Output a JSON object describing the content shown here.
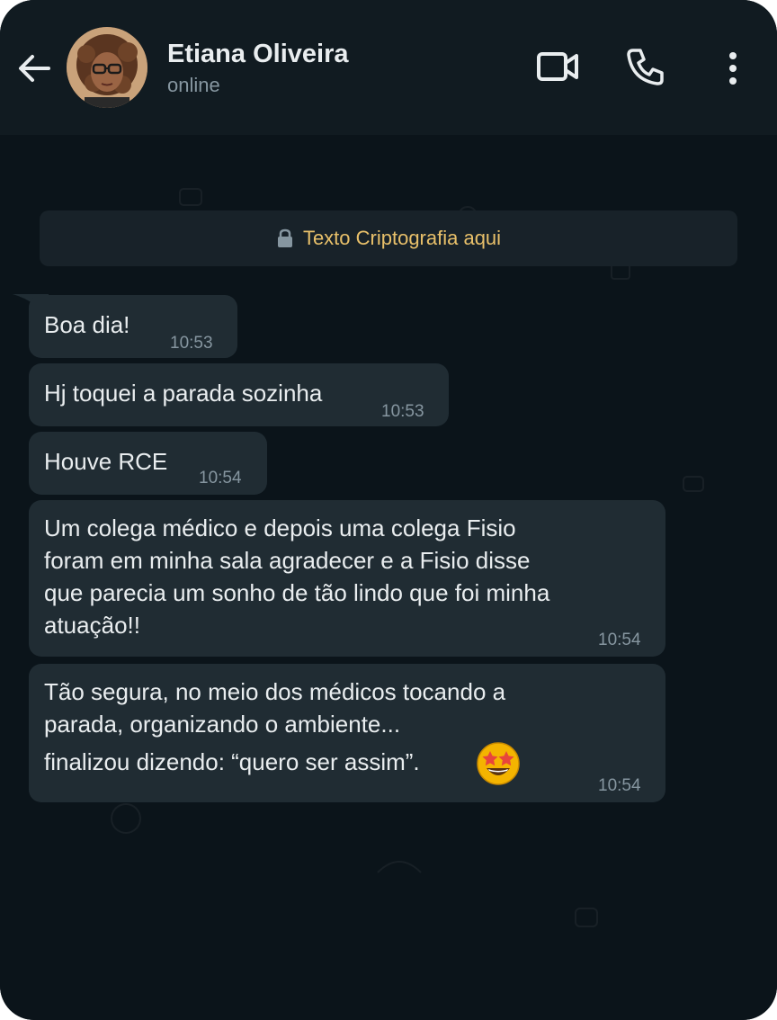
{
  "header": {
    "contact_name": "Etiana Oliveira",
    "status": "online"
  },
  "icons": [
    "back-arrow-icon",
    "video-call-icon",
    "phone-icon",
    "more-vertical-icon",
    "lock-icon",
    "star-struck-emoji"
  ],
  "colors": {
    "header_bg": "#111b21",
    "chat_bg": "#0b141a",
    "bubble_bg": "#202c33",
    "notice_text": "#e8c06a"
  },
  "system_notice": {
    "text": "Texto Criptografia aqui"
  },
  "messages": [
    {
      "lines": [
        "Boa dia!"
      ],
      "time": "10:53"
    },
    {
      "lines": [
        "Hj toquei a parada sozinha"
      ],
      "time": "10:53"
    },
    {
      "lines": [
        "Houve RCE"
      ],
      "time": "10:54"
    },
    {
      "lines": [
        "Um colega médico e depois uma colega Fisio",
        "foram em minha sala agradecer e a Fisio disse",
        "que parecia um sonho de tão lindo que foi minha",
        "atuação!!"
      ],
      "time": "10:54"
    },
    {
      "lines": [
        "Tão segura, no meio dos médicos tocando a",
        "parada, organizando o ambiente...",
        "finalizou dizendo: “quero ser assim”."
      ],
      "time": "10:54"
    }
  ]
}
